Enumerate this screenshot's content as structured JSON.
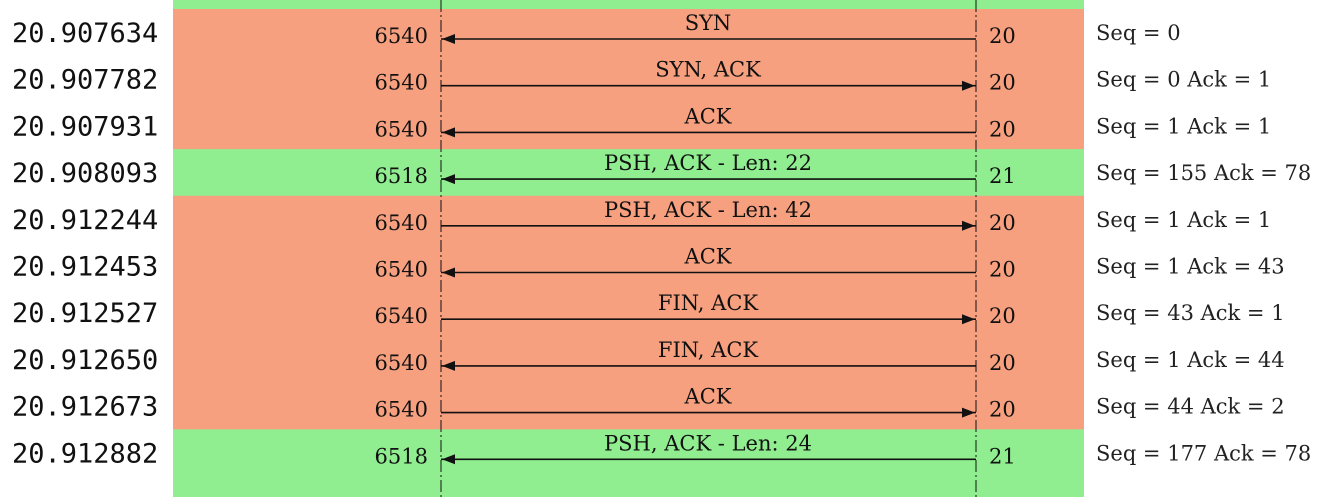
{
  "colors": {
    "tcp": "#F7A07F",
    "psh": "#90EE90",
    "line": "#111111"
  },
  "packets": [
    {
      "time": "20.907634",
      "left_port": "6540",
      "right_port": "20",
      "label": "SYN",
      "dir": "left",
      "comment": "Seq = 0",
      "color": "tcp"
    },
    {
      "time": "20.907782",
      "left_port": "6540",
      "right_port": "20",
      "label": "SYN, ACK",
      "dir": "right",
      "comment": "Seq = 0 Ack = 1",
      "color": "tcp"
    },
    {
      "time": "20.907931",
      "left_port": "6540",
      "right_port": "20",
      "label": "ACK",
      "dir": "left",
      "comment": "Seq = 1 Ack = 1",
      "color": "tcp"
    },
    {
      "time": "20.908093",
      "left_port": "6518",
      "right_port": "21",
      "label": "PSH, ACK - Len: 22",
      "dir": "left",
      "comment": "Seq = 155 Ack = 78",
      "color": "psh"
    },
    {
      "time": "20.912244",
      "left_port": "6540",
      "right_port": "20",
      "label": "PSH, ACK - Len: 42",
      "dir": "right",
      "comment": "Seq = 1 Ack = 1",
      "color": "tcp"
    },
    {
      "time": "20.912453",
      "left_port": "6540",
      "right_port": "20",
      "label": "ACK",
      "dir": "left",
      "comment": "Seq = 1 Ack = 43",
      "color": "tcp"
    },
    {
      "time": "20.912527",
      "left_port": "6540",
      "right_port": "20",
      "label": "FIN, ACK",
      "dir": "right",
      "comment": "Seq = 43 Ack = 1",
      "color": "tcp"
    },
    {
      "time": "20.912650",
      "left_port": "6540",
      "right_port": "20",
      "label": "FIN, ACK",
      "dir": "left",
      "comment": "Seq = 1 Ack = 44",
      "color": "tcp"
    },
    {
      "time": "20.912673",
      "left_port": "6540",
      "right_port": "20",
      "label": "ACK",
      "dir": "right",
      "comment": "Seq = 44 Ack = 2",
      "color": "tcp"
    },
    {
      "time": "20.912882",
      "left_port": "6518",
      "right_port": "21",
      "label": "PSH, ACK - Len: 24",
      "dir": "left",
      "comment": "Seq = 177 Ack = 78",
      "color": "psh"
    }
  ]
}
